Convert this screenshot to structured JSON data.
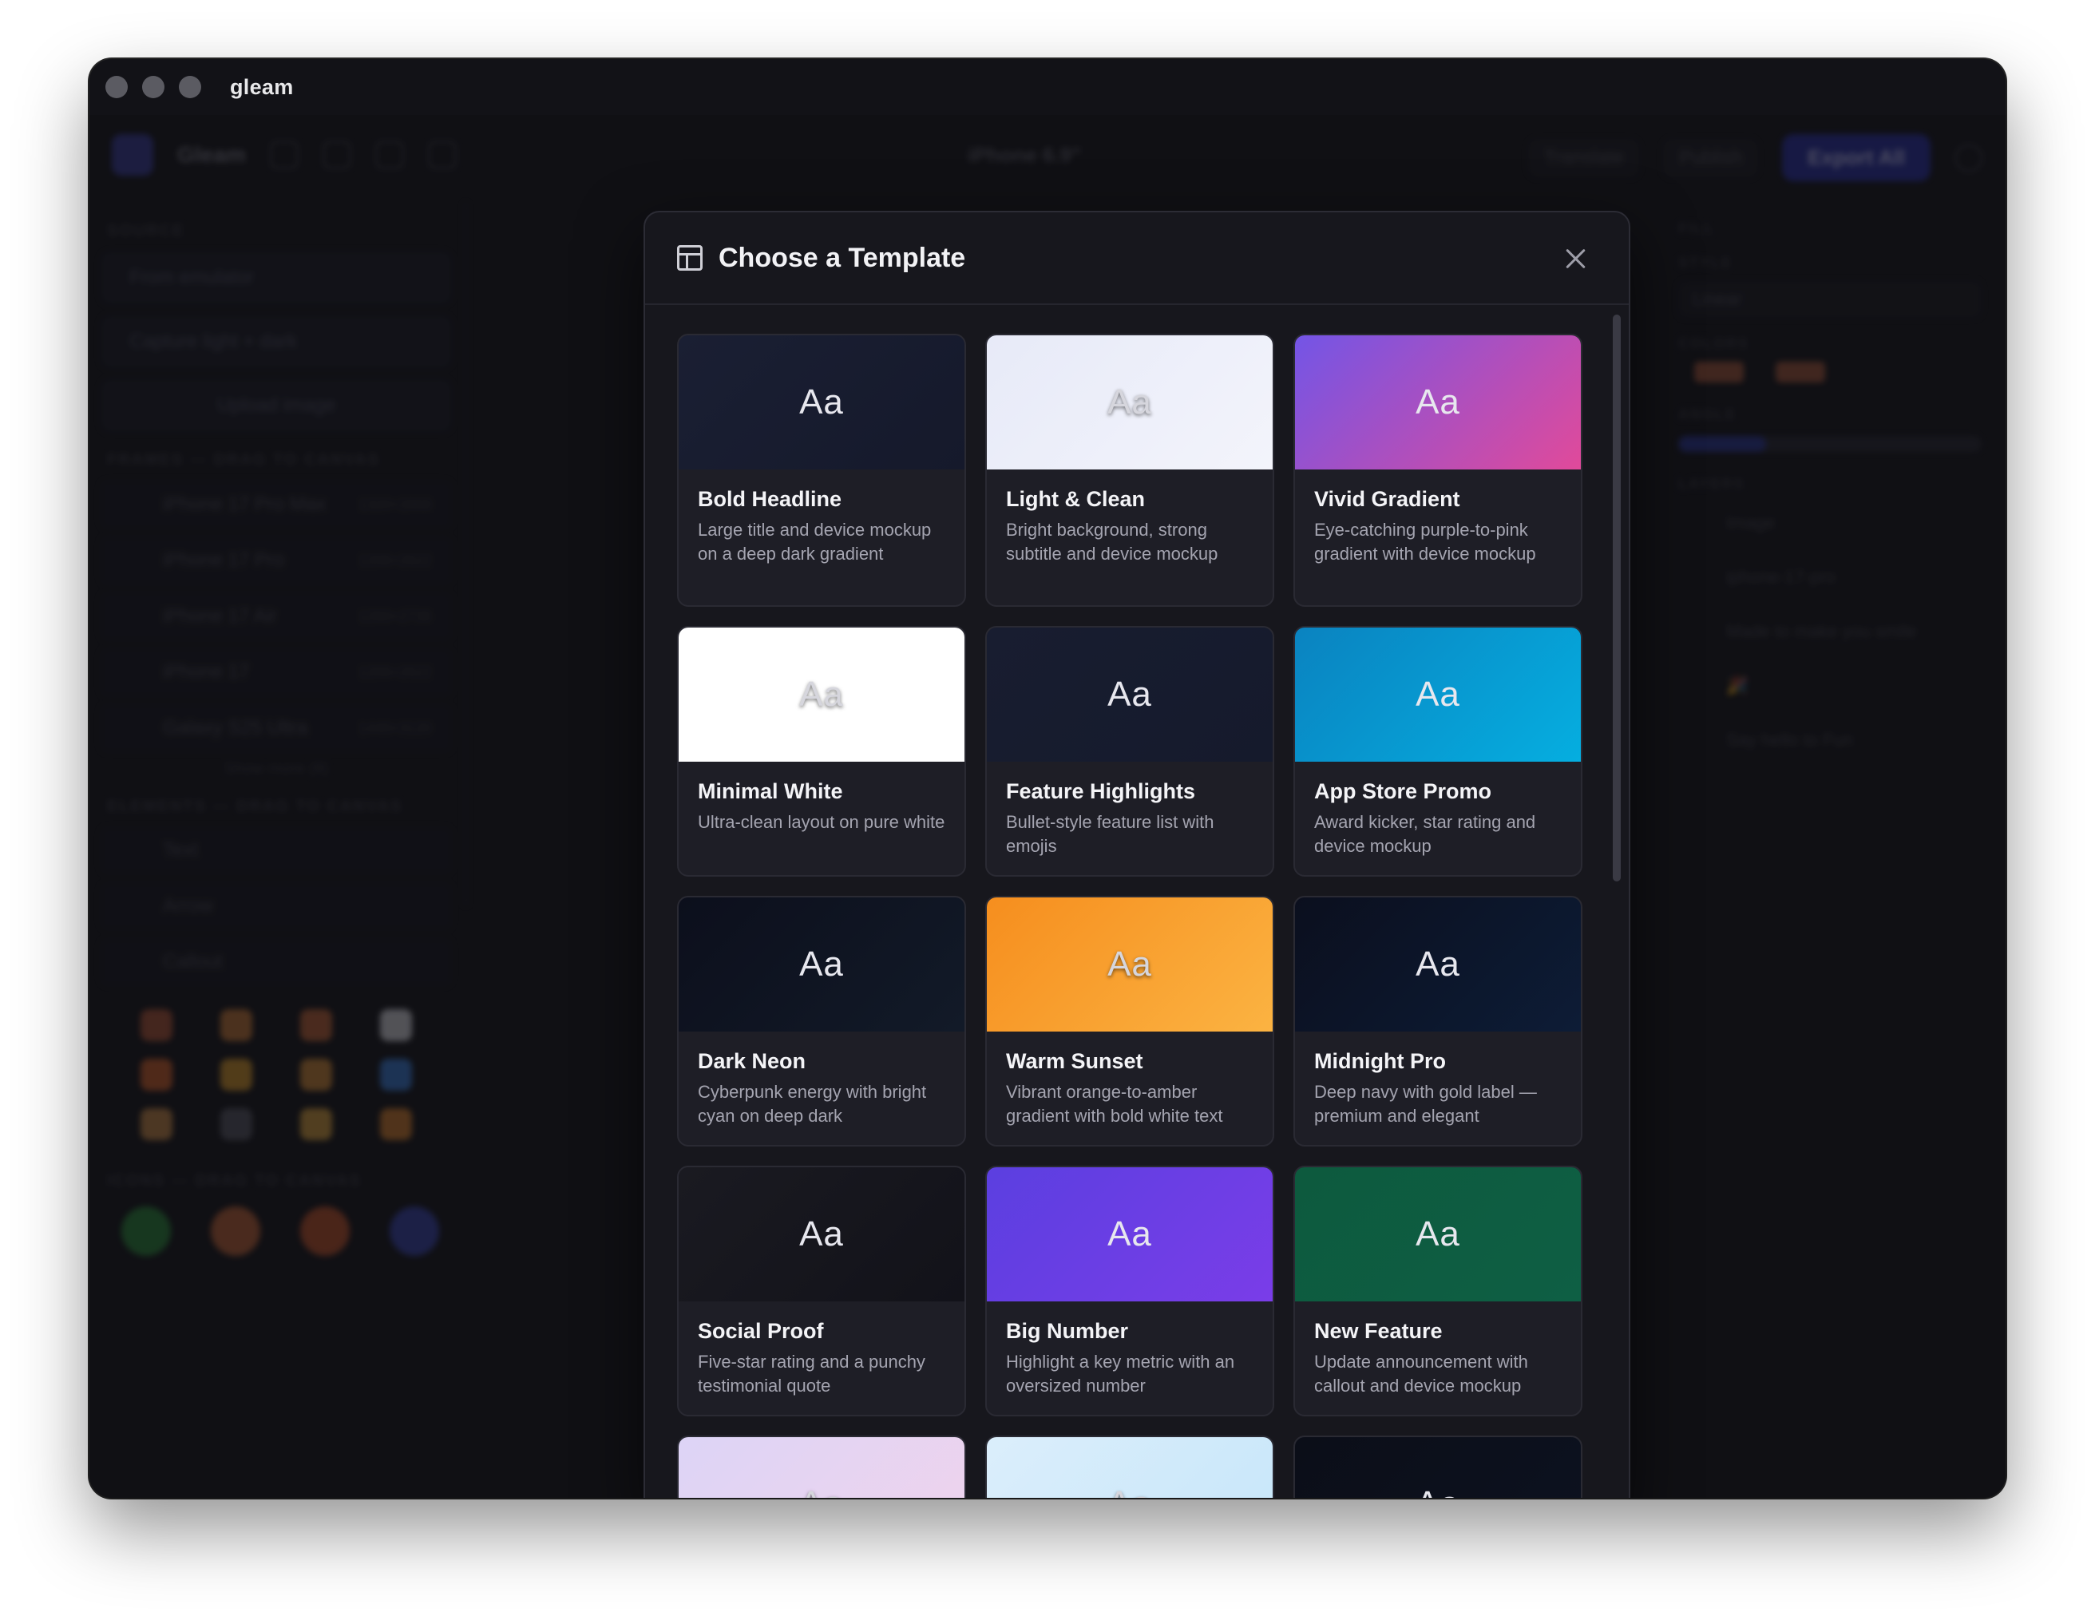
{
  "window": {
    "app_name": "gleam"
  },
  "background_app": {
    "brand": "Gleam",
    "device": "iPhone 6.9\"",
    "toolbar_buttons": [
      "Translate",
      "Publish"
    ],
    "export_label": "Export All",
    "sidebar_left": {
      "source_label": "SOURCE",
      "source_buttons": [
        "From emulator",
        "Capture light + dark",
        "Upload image"
      ],
      "frames_label": "FRAMES — DRAG TO CANVAS",
      "frames": [
        {
          "name": "iPhone 17 Pro Max",
          "size": "1320×2868"
        },
        {
          "name": "iPhone 17 Pro",
          "size": "1206×2622"
        },
        {
          "name": "iPhone 17 Air",
          "size": "1260×2736"
        },
        {
          "name": "iPhone 17",
          "size": "1206×2622"
        },
        {
          "name": "Galaxy S25 Ultra",
          "size": "1440×3120"
        }
      ],
      "show_more": "Show more (8)",
      "elements_label": "ELEMENTS — DRAG TO CANVAS",
      "elements": [
        "Text",
        "Arrow",
        "Callout"
      ],
      "icons_label": "ICONS — DRAG TO CANVAS",
      "emoji_colors": [
        "#b0573a",
        "#c77a3a",
        "#c0663a",
        "#d9d9e0",
        "#d0622e",
        "#d6982e",
        "#d08a3a",
        "#3d7fd8",
        "#c88a4a",
        "#5a5a66",
        "#d6a040",
        "#d48030"
      ],
      "sticker_colors": [
        "#2e8a3e",
        "#c0653a",
        "#c0552e",
        "#3b47b0"
      ]
    },
    "sidebar_right": {
      "fill_label": "FILL",
      "style_label": "STYLE",
      "style_value": "Linear",
      "colors_label": "COLORS",
      "angle_label": "ANGLE",
      "layers_label": "LAYERS",
      "layers": [
        "Image",
        "iphone-17-pro",
        "Made to make you smile",
        "🎉",
        "Say hello to Fun"
      ]
    }
  },
  "modal": {
    "title": "Choose a Template",
    "icon": "layout-template-icon",
    "close_icon": "close-icon",
    "templates": [
      {
        "name": "Bold Headline",
        "description": "Large title and device mockup on a deep dark gradient",
        "preview_text": "Aa",
        "bg_from": "#1a1f33",
        "bg_to": "#15192b",
        "light": false
      },
      {
        "name": "Light & Clean",
        "description": "Bright background, strong subtitle and device mockup",
        "preview_text": "Aa",
        "bg_from": "#e7eaf8",
        "bg_to": "#f3f4fb",
        "light": true
      },
      {
        "name": "Vivid Gradient",
        "description": "Eye-catching purple-to-pink gradient with device mockup",
        "preview_text": "Aa",
        "bg_from": "#7355e6",
        "bg_to": "#e14a9a",
        "light": false
      },
      {
        "name": "Minimal White",
        "description": "Ultra-clean layout on pure white",
        "preview_text": "Aa",
        "bg_from": "#ffffff",
        "bg_to": "#ffffff",
        "light": true
      },
      {
        "name": "Feature Highlights",
        "description": "Bullet-style feature list with emojis",
        "preview_text": "Aa",
        "bg_from": "#181d30",
        "bg_to": "#151a2c",
        "light": false
      },
      {
        "name": "App Store Promo",
        "description": "Award kicker, star rating and device mockup",
        "preview_text": "Aa",
        "bg_from": "#0a83c0",
        "bg_to": "#05aee0",
        "light": false
      },
      {
        "name": "Dark Neon",
        "description": "Cyberpunk energy with bright cyan on deep dark",
        "preview_text": "Aa",
        "bg_from": "#0c0f1c",
        "bg_to": "#121a28",
        "light": false
      },
      {
        "name": "Warm Sunset",
        "description": "Vibrant orange-to-amber gradient with bold white text",
        "preview_text": "Aa",
        "bg_from": "#f68e1e",
        "bg_to": "#fbb342",
        "light": true
      },
      {
        "name": "Midnight Pro",
        "description": "Deep navy with gold label — premium and elegant",
        "preview_text": "Aa",
        "bg_from": "#0b0f1e",
        "bg_to": "#0d1c36",
        "light": false
      },
      {
        "name": "Social Proof",
        "description": "Five-star rating and a punchy testimonial quote",
        "preview_text": "Aa",
        "bg_from": "#1a1a21",
        "bg_to": "#121219",
        "light": false
      },
      {
        "name": "Big Number",
        "description": "Highlight a key metric with an oversized number",
        "preview_text": "Aa",
        "bg_from": "#5b3fe0",
        "bg_to": "#7a3de8",
        "light": false
      },
      {
        "name": "New Feature",
        "description": "Update announcement with callout and device mockup",
        "preview_text": "Aa",
        "bg_from": "#0d5a3e",
        "bg_to": "#0e5f44",
        "light": false
      },
      {
        "name": "",
        "description": "",
        "preview_text": "Aa",
        "bg_from": "#ddd4f6",
        "bg_to": "#f0d3ec",
        "light": true
      },
      {
        "name": "",
        "description": "",
        "preview_text": "Aa",
        "bg_from": "#dbeefb",
        "bg_to": "#c6e6fa",
        "light": true
      },
      {
        "name": "",
        "description": "",
        "preview_text": "Aa",
        "bg_from": "#0b0e18",
        "bg_to": "#0d1220",
        "light": false
      }
    ]
  }
}
